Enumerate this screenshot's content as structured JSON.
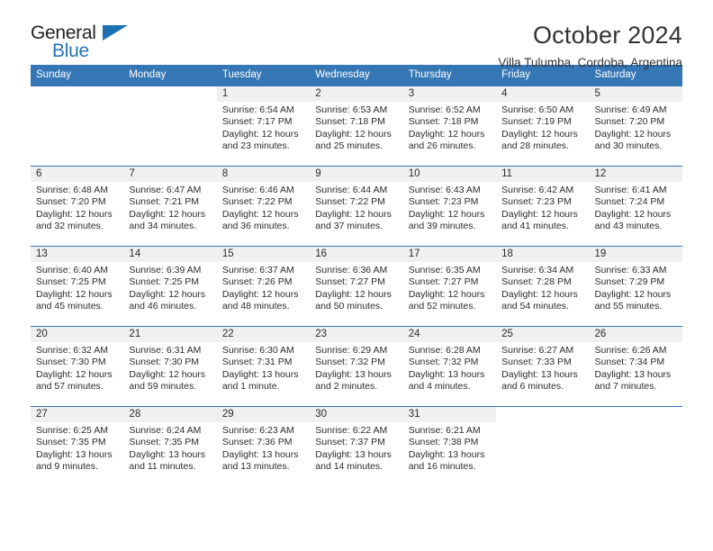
{
  "brand": {
    "name_top": "General",
    "name_bottom": "Blue",
    "triangle_color": "#1b6fb3",
    "blue_text_color": "#2372b8"
  },
  "header": {
    "title": "October 2024",
    "subtitle": "Villa Tulumba, Cordoba, Argentina"
  },
  "theme": {
    "header_blue": "#3577b5",
    "daynum_band": "#f0f0f0",
    "text": "#2b2b2b"
  },
  "weekdays": [
    "Sunday",
    "Monday",
    "Tuesday",
    "Wednesday",
    "Thursday",
    "Friday",
    "Saturday"
  ],
  "weeks": [
    [
      {
        "day": "",
        "details": "",
        "blank": true
      },
      {
        "day": "",
        "details": "",
        "blank": true
      },
      {
        "day": "1",
        "details": "Sunrise: 6:54 AM\nSunset: 7:17 PM\nDaylight: 12 hours\nand 23 minutes."
      },
      {
        "day": "2",
        "details": "Sunrise: 6:53 AM\nSunset: 7:18 PM\nDaylight: 12 hours\nand 25 minutes."
      },
      {
        "day": "3",
        "details": "Sunrise: 6:52 AM\nSunset: 7:18 PM\nDaylight: 12 hours\nand 26 minutes."
      },
      {
        "day": "4",
        "details": "Sunrise: 6:50 AM\nSunset: 7:19 PM\nDaylight: 12 hours\nand 28 minutes."
      },
      {
        "day": "5",
        "details": "Sunrise: 6:49 AM\nSunset: 7:20 PM\nDaylight: 12 hours\nand 30 minutes."
      }
    ],
    [
      {
        "day": "6",
        "details": "Sunrise: 6:48 AM\nSunset: 7:20 PM\nDaylight: 12 hours\nand 32 minutes."
      },
      {
        "day": "7",
        "details": "Sunrise: 6:47 AM\nSunset: 7:21 PM\nDaylight: 12 hours\nand 34 minutes."
      },
      {
        "day": "8",
        "details": "Sunrise: 6:46 AM\nSunset: 7:22 PM\nDaylight: 12 hours\nand 36 minutes."
      },
      {
        "day": "9",
        "details": "Sunrise: 6:44 AM\nSunset: 7:22 PM\nDaylight: 12 hours\nand 37 minutes."
      },
      {
        "day": "10",
        "details": "Sunrise: 6:43 AM\nSunset: 7:23 PM\nDaylight: 12 hours\nand 39 minutes."
      },
      {
        "day": "11",
        "details": "Sunrise: 6:42 AM\nSunset: 7:23 PM\nDaylight: 12 hours\nand 41 minutes."
      },
      {
        "day": "12",
        "details": "Sunrise: 6:41 AM\nSunset: 7:24 PM\nDaylight: 12 hours\nand 43 minutes."
      }
    ],
    [
      {
        "day": "13",
        "details": "Sunrise: 6:40 AM\nSunset: 7:25 PM\nDaylight: 12 hours\nand 45 minutes."
      },
      {
        "day": "14",
        "details": "Sunrise: 6:39 AM\nSunset: 7:25 PM\nDaylight: 12 hours\nand 46 minutes."
      },
      {
        "day": "15",
        "details": "Sunrise: 6:37 AM\nSunset: 7:26 PM\nDaylight: 12 hours\nand 48 minutes."
      },
      {
        "day": "16",
        "details": "Sunrise: 6:36 AM\nSunset: 7:27 PM\nDaylight: 12 hours\nand 50 minutes."
      },
      {
        "day": "17",
        "details": "Sunrise: 6:35 AM\nSunset: 7:27 PM\nDaylight: 12 hours\nand 52 minutes."
      },
      {
        "day": "18",
        "details": "Sunrise: 6:34 AM\nSunset: 7:28 PM\nDaylight: 12 hours\nand 54 minutes."
      },
      {
        "day": "19",
        "details": "Sunrise: 6:33 AM\nSunset: 7:29 PM\nDaylight: 12 hours\nand 55 minutes."
      }
    ],
    [
      {
        "day": "20",
        "details": "Sunrise: 6:32 AM\nSunset: 7:30 PM\nDaylight: 12 hours\nand 57 minutes."
      },
      {
        "day": "21",
        "details": "Sunrise: 6:31 AM\nSunset: 7:30 PM\nDaylight: 12 hours\nand 59 minutes."
      },
      {
        "day": "22",
        "details": "Sunrise: 6:30 AM\nSunset: 7:31 PM\nDaylight: 13 hours\nand 1 minute."
      },
      {
        "day": "23",
        "details": "Sunrise: 6:29 AM\nSunset: 7:32 PM\nDaylight: 13 hours\nand 2 minutes."
      },
      {
        "day": "24",
        "details": "Sunrise: 6:28 AM\nSunset: 7:32 PM\nDaylight: 13 hours\nand 4 minutes."
      },
      {
        "day": "25",
        "details": "Sunrise: 6:27 AM\nSunset: 7:33 PM\nDaylight: 13 hours\nand 6 minutes."
      },
      {
        "day": "26",
        "details": "Sunrise: 6:26 AM\nSunset: 7:34 PM\nDaylight: 13 hours\nand 7 minutes."
      }
    ],
    [
      {
        "day": "27",
        "details": "Sunrise: 6:25 AM\nSunset: 7:35 PM\nDaylight: 13 hours\nand 9 minutes."
      },
      {
        "day": "28",
        "details": "Sunrise: 6:24 AM\nSunset: 7:35 PM\nDaylight: 13 hours\nand 11 minutes."
      },
      {
        "day": "29",
        "details": "Sunrise: 6:23 AM\nSunset: 7:36 PM\nDaylight: 13 hours\nand 13 minutes."
      },
      {
        "day": "30",
        "details": "Sunrise: 6:22 AM\nSunset: 7:37 PM\nDaylight: 13 hours\nand 14 minutes."
      },
      {
        "day": "31",
        "details": "Sunrise: 6:21 AM\nSunset: 7:38 PM\nDaylight: 13 hours\nand 16 minutes."
      },
      {
        "day": "",
        "details": "",
        "blank": true
      },
      {
        "day": "",
        "details": "",
        "blank": true
      }
    ]
  ]
}
